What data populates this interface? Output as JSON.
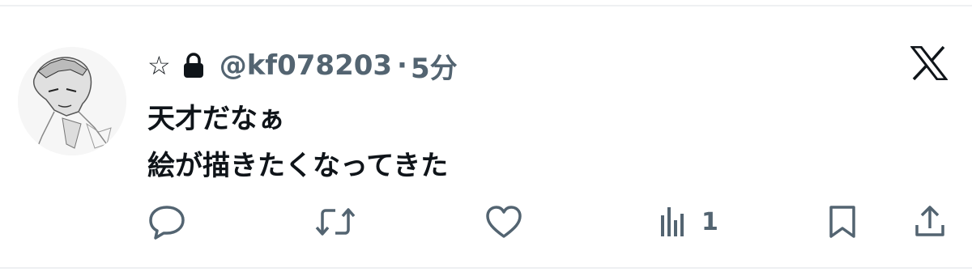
{
  "post": {
    "name_glyph": "☆",
    "handle": "@kf078203",
    "separator": "·",
    "time": "5分",
    "lines": [
      "天才だなぁ",
      "絵が描きたくなってきた"
    ]
  },
  "actions": {
    "views_count": "1"
  },
  "icons": {
    "lock": "lock-icon",
    "x_logo": "x-logo-icon",
    "reply": "reply-icon",
    "repost": "repost-icon",
    "like": "like-icon",
    "views": "views-icon",
    "bookmark": "bookmark-icon",
    "share": "share-icon"
  },
  "colors": {
    "text_primary": "#0f1419",
    "text_secondary": "#536471",
    "divider": "#eef0f2"
  }
}
